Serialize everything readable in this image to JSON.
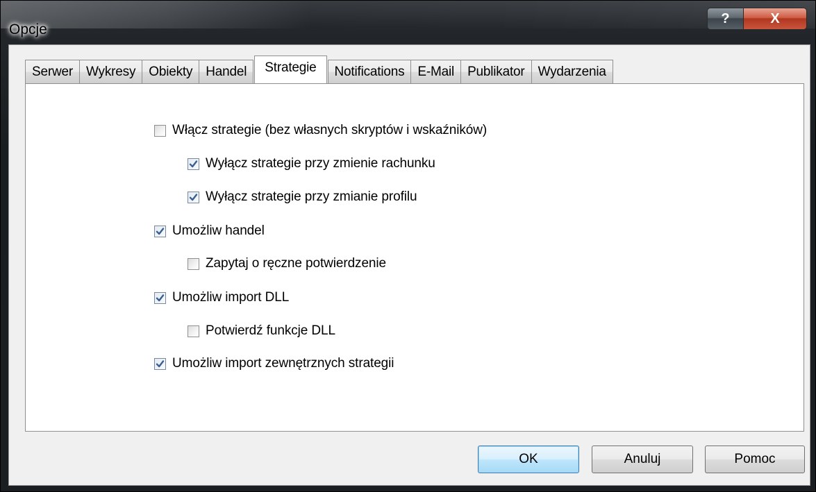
{
  "window": {
    "title": "Opcje",
    "help_label": "?",
    "close_label": "X"
  },
  "tabs": [
    {
      "label": "Serwer",
      "active": false
    },
    {
      "label": "Wykresy",
      "active": false
    },
    {
      "label": "Obiekty",
      "active": false
    },
    {
      "label": "Handel",
      "active": false
    },
    {
      "label": "Strategie",
      "active": true
    },
    {
      "label": "Notifications",
      "active": false
    },
    {
      "label": "E-Mail",
      "active": false
    },
    {
      "label": "Publikator",
      "active": false
    },
    {
      "label": "Wydarzenia",
      "active": false
    }
  ],
  "options": [
    {
      "label": "Włącz strategie (bez własnych skryptów i wskaźników)",
      "checked": false,
      "indent": 0
    },
    {
      "label": "Wyłącz strategie przy zmienie rachunku",
      "checked": true,
      "indent": 1
    },
    {
      "label": "Wyłącz strategie przy zmianie profilu",
      "checked": true,
      "indent": 1
    },
    {
      "label": "Umożliw handel",
      "checked": true,
      "indent": 0
    },
    {
      "label": "Zapytaj o ręczne potwierdzenie",
      "checked": false,
      "indent": 1
    },
    {
      "label": "Umożliw import DLL",
      "checked": true,
      "indent": 0
    },
    {
      "label": "Potwierdź funkcje DLL",
      "checked": false,
      "indent": 1
    },
    {
      "label": "Umożliw import zewnętrznych strategii",
      "checked": true,
      "indent": 0
    }
  ],
  "buttons": {
    "ok": "OK",
    "cancel": "Anuluj",
    "help": "Pomoc"
  },
  "colors": {
    "check_mark": "#3a5f8c",
    "default_button_border": "#3c7fb1"
  }
}
